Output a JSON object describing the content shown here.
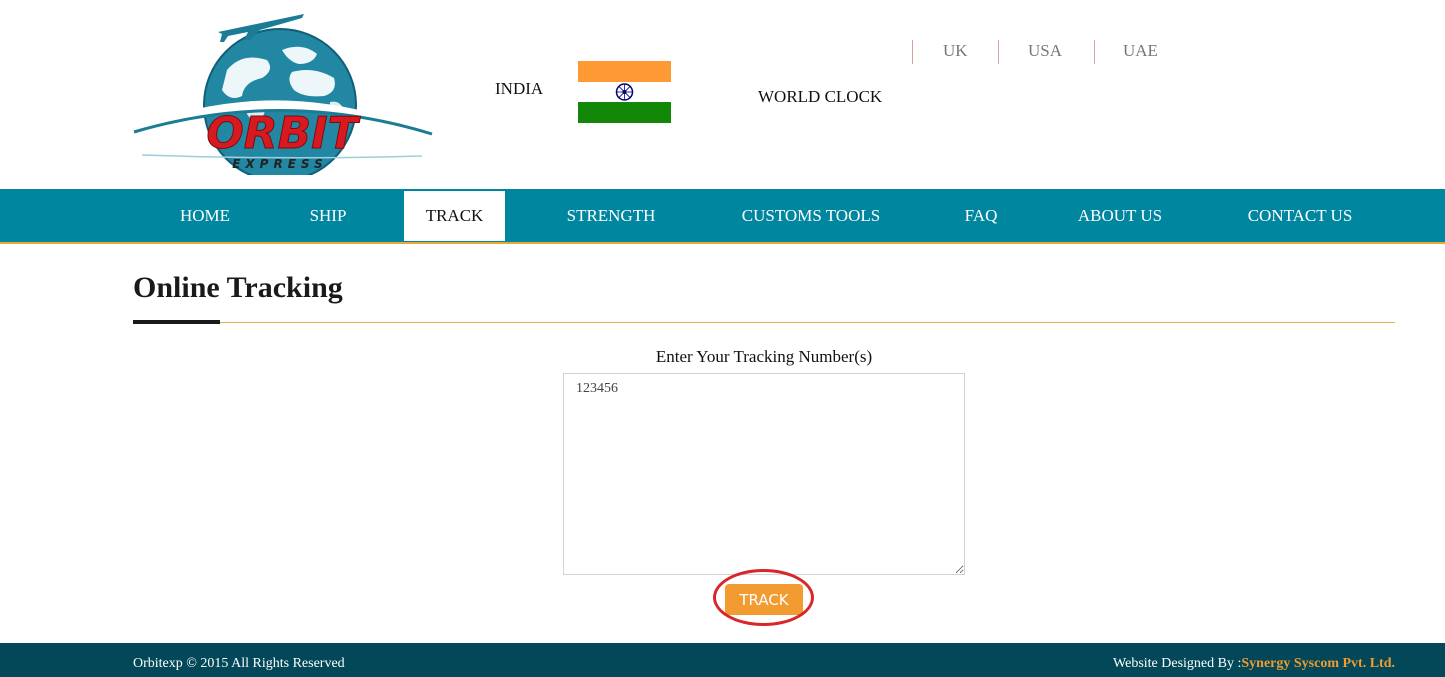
{
  "header": {
    "logo": {
      "brand_text": "ORBIT",
      "tagline": "EXPRESS",
      "icon": "globe-airplane-logo"
    },
    "country_label": "INDIA",
    "flag_icon": "india-flag-icon",
    "world_clock_label": "WORLD CLOCK",
    "region_links": [
      {
        "label": "UK"
      },
      {
        "label": "USA"
      },
      {
        "label": "UAE"
      }
    ]
  },
  "nav": {
    "items": [
      {
        "label": "HOME"
      },
      {
        "label": "SHIP"
      },
      {
        "label": "TRACK"
      },
      {
        "label": "STRENGTH"
      },
      {
        "label": "CUSTOMS TOOLS"
      },
      {
        "label": "FAQ"
      },
      {
        "label": "ABOUT US"
      },
      {
        "label": "CONTACT US"
      }
    ],
    "active": "TRACK"
  },
  "main": {
    "title": "Online Tracking",
    "tracking_label": "Enter Your Tracking Number(s)",
    "tracking_value": "123456",
    "track_button_label": "TRACK"
  },
  "footer": {
    "copyright": "Orbitexp © 2015 All Rights Reserved",
    "credit_prefix": "Website Designed By :",
    "credit_company": "Synergy Syscom Pvt. Ltd."
  },
  "colors": {
    "nav_bg": "#00869e",
    "nav_border": "#e6a83a",
    "footer_bg": "#024858",
    "button_bg": "#f29b30",
    "highlight": "#d9262b",
    "logo_red": "#d71920",
    "logo_teal": "#1b7d95"
  }
}
